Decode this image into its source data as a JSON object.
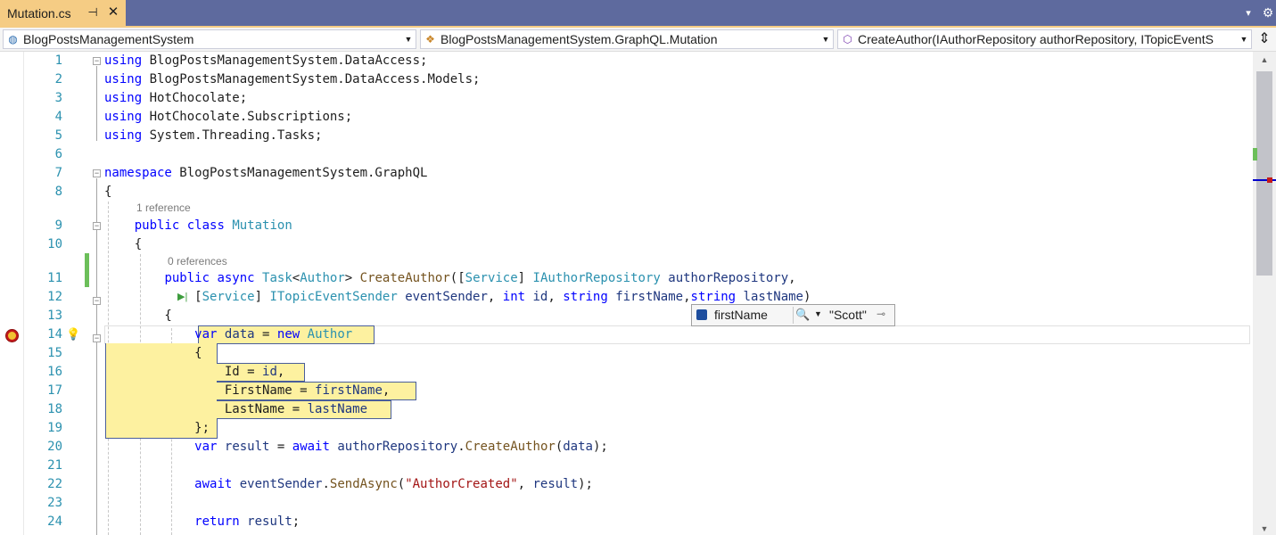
{
  "tab": {
    "title": "Mutation.cs",
    "pin_glyph": "⊣",
    "close_glyph": "✕"
  },
  "titlebar": {
    "tab_list_glyph": "▾",
    "settings_glyph": "⚙"
  },
  "navbar": {
    "project": {
      "icon": "project-icon",
      "label": "BlogPostsManagementSystem"
    },
    "type": {
      "icon": "class-icon",
      "label": "BlogPostsManagementSystem.GraphQL.Mutation"
    },
    "member": {
      "icon": "method-icon",
      "label": "CreateAuthor(IAuthorRepository authorRepository, ITopicEventS"
    },
    "split_glyph": "⇕"
  },
  "colors": {
    "tab_bg": "#f5cc84",
    "band_bg": "#5e6a9e",
    "highlight": "#fdf1a0",
    "keyword": "#0000ff",
    "type": "#2b91af"
  },
  "code_lens": {
    "class_refs": "1 reference",
    "method_refs": "0 references"
  },
  "datatip": {
    "name": "firstName",
    "value": "\"Scott\"",
    "search_glyph": "🔍",
    "drop_glyph": "▼",
    "pin_glyph": "⊸"
  },
  "gutter": {
    "run_to_glyph": "▶|",
    "bulb_glyph": "💡"
  },
  "lines": [
    {
      "n": "1",
      "tokens": [
        {
          "t": "using",
          "c": "kw"
        },
        {
          "t": " BlogPostsManagementSystem.DataAccess;",
          "c": ""
        }
      ]
    },
    {
      "n": "2",
      "tokens": [
        {
          "t": "using",
          "c": "kw"
        },
        {
          "t": " BlogPostsManagementSystem.DataAccess.Models;",
          "c": ""
        }
      ]
    },
    {
      "n": "3",
      "tokens": [
        {
          "t": "using",
          "c": "kw"
        },
        {
          "t": " HotChocolate;",
          "c": ""
        }
      ]
    },
    {
      "n": "4",
      "tokens": [
        {
          "t": "using",
          "c": "kw"
        },
        {
          "t": " HotChocolate.Subscriptions;",
          "c": ""
        }
      ]
    },
    {
      "n": "5",
      "tokens": [
        {
          "t": "using",
          "c": "kw"
        },
        {
          "t": " System.Threading.Tasks;",
          "c": ""
        }
      ]
    },
    {
      "n": "6",
      "tokens": []
    },
    {
      "n": "7",
      "tokens": [
        {
          "t": "namespace",
          "c": "kw"
        },
        {
          "t": " BlogPostsManagementSystem.GraphQL",
          "c": ""
        }
      ]
    },
    {
      "n": "8",
      "tokens": [
        {
          "t": "{",
          "c": ""
        }
      ]
    },
    {
      "n": "9",
      "tokens": [
        {
          "t": "    ",
          "c": ""
        },
        {
          "t": "public",
          "c": "kw"
        },
        {
          "t": " ",
          "c": ""
        },
        {
          "t": "class",
          "c": "kw"
        },
        {
          "t": " ",
          "c": ""
        },
        {
          "t": "Mutation",
          "c": "ty"
        }
      ]
    },
    {
      "n": "10",
      "tokens": [
        {
          "t": "    {",
          "c": ""
        }
      ]
    },
    {
      "n": "11",
      "tokens": [
        {
          "t": "        ",
          "c": ""
        },
        {
          "t": "public",
          "c": "kw"
        },
        {
          "t": " ",
          "c": ""
        },
        {
          "t": "async",
          "c": "kw"
        },
        {
          "t": " ",
          "c": ""
        },
        {
          "t": "Task",
          "c": "ty"
        },
        {
          "t": "<",
          "c": ""
        },
        {
          "t": "Author",
          "c": "ty"
        },
        {
          "t": "> ",
          "c": ""
        },
        {
          "t": "CreateAuthor",
          "c": "mt"
        },
        {
          "t": "([",
          "c": ""
        },
        {
          "t": "Service",
          "c": "ty"
        },
        {
          "t": "] ",
          "c": ""
        },
        {
          "t": "IAuthorRepository",
          "c": "ty"
        },
        {
          "t": " ",
          "c": ""
        },
        {
          "t": "authorRepository",
          "c": "pr"
        },
        {
          "t": ",",
          "c": ""
        }
      ]
    },
    {
      "n": "12",
      "tokens": [
        {
          "t": "            [",
          "c": ""
        },
        {
          "t": "Service",
          "c": "ty"
        },
        {
          "t": "] ",
          "c": ""
        },
        {
          "t": "ITopicEventSender",
          "c": "ty"
        },
        {
          "t": " ",
          "c": ""
        },
        {
          "t": "eventSender",
          "c": "pr"
        },
        {
          "t": ", ",
          "c": ""
        },
        {
          "t": "int",
          "c": "kw"
        },
        {
          "t": " ",
          "c": ""
        },
        {
          "t": "id",
          "c": "pr"
        },
        {
          "t": ", ",
          "c": ""
        },
        {
          "t": "string",
          "c": "kw"
        },
        {
          "t": " ",
          "c": ""
        },
        {
          "t": "firstName",
          "c": "pr"
        },
        {
          "t": ",",
          "c": ""
        },
        {
          "t": "string",
          "c": "kw"
        },
        {
          "t": " ",
          "c": ""
        },
        {
          "t": "lastName",
          "c": "pr"
        },
        {
          "t": ")",
          "c": ""
        }
      ]
    },
    {
      "n": "13",
      "tokens": [
        {
          "t": "        {",
          "c": ""
        }
      ]
    },
    {
      "n": "14",
      "tokens": [
        {
          "t": "            ",
          "c": ""
        },
        {
          "t": "var",
          "c": "kw"
        },
        {
          "t": " ",
          "c": ""
        },
        {
          "t": "data",
          "c": "pr"
        },
        {
          "t": " = ",
          "c": ""
        },
        {
          "t": "new",
          "c": "kw"
        },
        {
          "t": " ",
          "c": ""
        },
        {
          "t": "Author",
          "c": "ty"
        }
      ]
    },
    {
      "n": "15",
      "tokens": [
        {
          "t": "            {",
          "c": ""
        }
      ]
    },
    {
      "n": "16",
      "tokens": [
        {
          "t": "                Id = ",
          "c": ""
        },
        {
          "t": "id",
          "c": "pr"
        },
        {
          "t": ",",
          "c": ""
        }
      ]
    },
    {
      "n": "17",
      "tokens": [
        {
          "t": "                FirstName = ",
          "c": ""
        },
        {
          "t": "firstName",
          "c": "pr"
        },
        {
          "t": ",",
          "c": ""
        }
      ]
    },
    {
      "n": "18",
      "tokens": [
        {
          "t": "                LastName = ",
          "c": ""
        },
        {
          "t": "lastName",
          "c": "pr"
        }
      ]
    },
    {
      "n": "19",
      "tokens": [
        {
          "t": "            };",
          "c": ""
        }
      ]
    },
    {
      "n": "20",
      "tokens": [
        {
          "t": "            ",
          "c": ""
        },
        {
          "t": "var",
          "c": "kw"
        },
        {
          "t": " ",
          "c": ""
        },
        {
          "t": "result",
          "c": "pr"
        },
        {
          "t": " = ",
          "c": ""
        },
        {
          "t": "await",
          "c": "kw"
        },
        {
          "t": " ",
          "c": ""
        },
        {
          "t": "authorRepository",
          "c": "pr"
        },
        {
          "t": ".",
          "c": ""
        },
        {
          "t": "CreateAuthor",
          "c": "mt"
        },
        {
          "t": "(",
          "c": ""
        },
        {
          "t": "data",
          "c": "pr"
        },
        {
          "t": ");",
          "c": ""
        }
      ]
    },
    {
      "n": "21",
      "tokens": []
    },
    {
      "n": "22",
      "tokens": [
        {
          "t": "            ",
          "c": ""
        },
        {
          "t": "await",
          "c": "kw"
        },
        {
          "t": " ",
          "c": ""
        },
        {
          "t": "eventSender",
          "c": "pr"
        },
        {
          "t": ".",
          "c": ""
        },
        {
          "t": "SendAsync",
          "c": "mt"
        },
        {
          "t": "(",
          "c": ""
        },
        {
          "t": "\"AuthorCreated\"",
          "c": "st"
        },
        {
          "t": ", ",
          "c": ""
        },
        {
          "t": "result",
          "c": "pr"
        },
        {
          "t": ");",
          "c": ""
        }
      ]
    },
    {
      "n": "23",
      "tokens": []
    },
    {
      "n": "24",
      "tokens": [
        {
          "t": "            ",
          "c": ""
        },
        {
          "t": "return",
          "c": "kw"
        },
        {
          "t": " ",
          "c": ""
        },
        {
          "t": "result",
          "c": "pr"
        },
        {
          "t": ";",
          "c": ""
        }
      ]
    }
  ]
}
